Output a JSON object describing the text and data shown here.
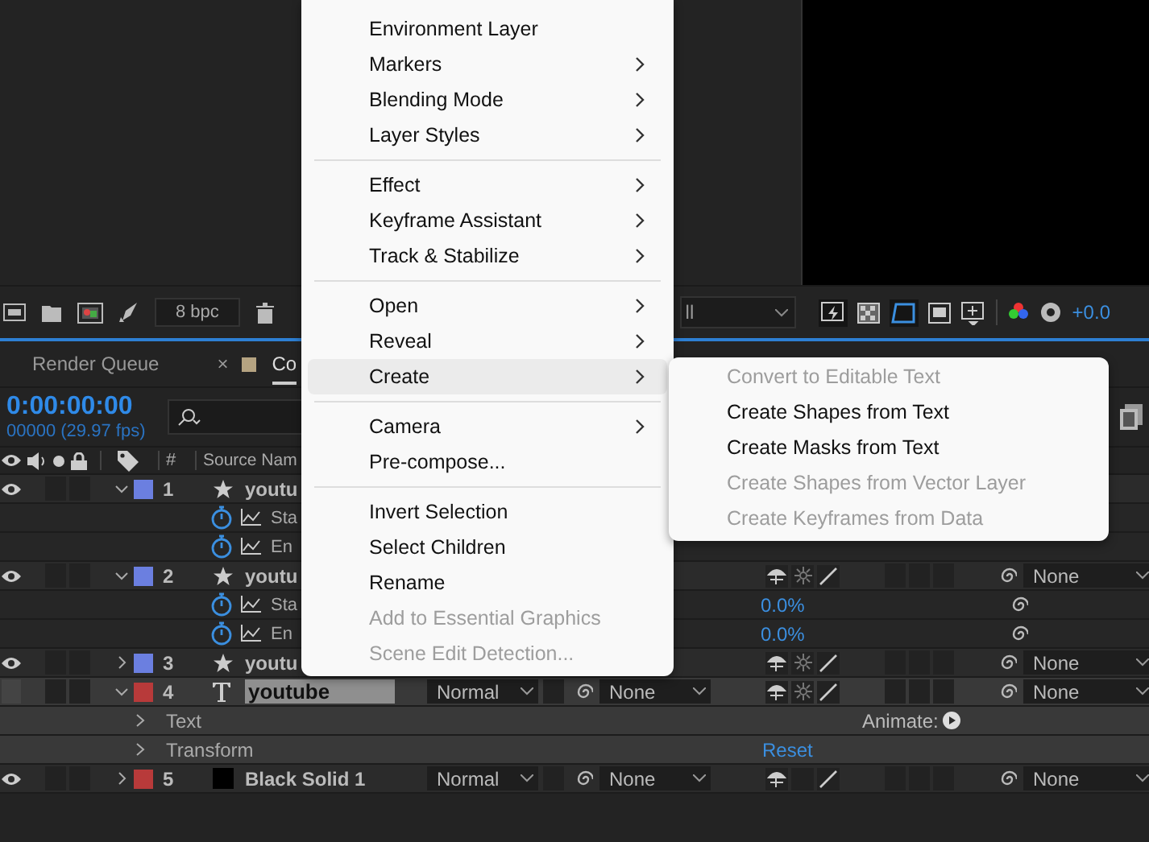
{
  "toolbar": {
    "bit_depth": "8 bpc"
  },
  "viewer_toolbar": {
    "resolution": "ll",
    "exposure": "+0.0"
  },
  "tabs": [
    {
      "label": "Render Queue",
      "selected": false
    },
    {
      "label": "Co",
      "selected": true,
      "close": "×",
      "color": "#b5a381"
    }
  ],
  "timeline": {
    "timecode": "0:00:00:00",
    "frames": "00000 (29.97 fps)",
    "columns": [
      "#",
      "Source Nam"
    ],
    "layers": [
      {
        "index": "1",
        "name": "youtu",
        "kind": "shape",
        "color": "#6b7fe0",
        "visible": true,
        "expanded": true,
        "selected": false,
        "children": [
          {
            "kind": "property",
            "name": "Sta"
          },
          {
            "kind": "property",
            "name": "En"
          }
        ]
      },
      {
        "index": "2",
        "name": "youtu",
        "kind": "shape",
        "color": "#6b7fe0",
        "visible": true,
        "expanded": true,
        "selected": false,
        "parent": "None",
        "children": [
          {
            "kind": "property",
            "name": "Sta",
            "value": "0.0%"
          },
          {
            "kind": "property",
            "name": "En",
            "value": "0.0%"
          }
        ]
      },
      {
        "index": "3",
        "name": "youtu",
        "kind": "shape",
        "color": "#6b7fe0",
        "visible": true,
        "expanded": false,
        "selected": false,
        "parent": "None"
      },
      {
        "index": "4",
        "name": "youtube",
        "kind": "text",
        "color": "#b83a3a",
        "visible": false,
        "expanded": true,
        "selected": true,
        "renaming": true,
        "mode": "Normal",
        "track_matte": "None",
        "parent": "None",
        "children": [
          {
            "kind": "group",
            "name": "Text",
            "animate": "Animate:"
          },
          {
            "kind": "group",
            "name": "Transform",
            "value": "Reset"
          }
        ]
      },
      {
        "index": "5",
        "name": "Black Solid 1",
        "kind": "solid",
        "color": "#b83a3a",
        "visible": true,
        "expanded": false,
        "selected": false,
        "mode": "Normal",
        "track_matte": "None",
        "parent": "None"
      }
    ]
  },
  "context_menu": {
    "items": [
      {
        "kind": "item",
        "label": "Environment Layer",
        "submenu": false,
        "disabled": false,
        "selected": false
      },
      {
        "kind": "item",
        "label": "Markers",
        "submenu": true,
        "disabled": false,
        "selected": false
      },
      {
        "kind": "item",
        "label": "Blending Mode",
        "submenu": true,
        "disabled": false,
        "selected": false
      },
      {
        "kind": "item",
        "label": "Layer Styles",
        "submenu": true,
        "disabled": false,
        "selected": false
      },
      {
        "kind": "separator"
      },
      {
        "kind": "item",
        "label": "Effect",
        "submenu": true,
        "disabled": false,
        "selected": false
      },
      {
        "kind": "item",
        "label": "Keyframe Assistant",
        "submenu": true,
        "disabled": false,
        "selected": false
      },
      {
        "kind": "item",
        "label": "Track & Stabilize",
        "submenu": true,
        "disabled": false,
        "selected": false
      },
      {
        "kind": "separator"
      },
      {
        "kind": "item",
        "label": "Open",
        "submenu": true,
        "disabled": false,
        "selected": false
      },
      {
        "kind": "item",
        "label": "Reveal",
        "submenu": true,
        "disabled": false,
        "selected": false
      },
      {
        "kind": "item",
        "label": "Create",
        "submenu": true,
        "disabled": false,
        "selected": true
      },
      {
        "kind": "separator"
      },
      {
        "kind": "item",
        "label": "Camera",
        "submenu": true,
        "disabled": false,
        "selected": false
      },
      {
        "kind": "item",
        "label": "Pre-compose...",
        "submenu": false,
        "disabled": false,
        "selected": false
      },
      {
        "kind": "separator"
      },
      {
        "kind": "item",
        "label": "Invert Selection",
        "submenu": false,
        "disabled": false,
        "selected": false
      },
      {
        "kind": "item",
        "label": "Select Children",
        "submenu": false,
        "disabled": false,
        "selected": false
      },
      {
        "kind": "item",
        "label": "Rename",
        "submenu": false,
        "disabled": false,
        "selected": false
      },
      {
        "kind": "item",
        "label": "Add to Essential Graphics",
        "submenu": false,
        "disabled": true,
        "selected": false
      },
      {
        "kind": "item",
        "label": "Scene Edit Detection...",
        "submenu": false,
        "disabled": true,
        "selected": false
      }
    ]
  },
  "submenu": {
    "items": [
      {
        "label": "Convert to Editable Text",
        "disabled": true
      },
      {
        "label": "Create Shapes from Text",
        "disabled": false
      },
      {
        "label": "Create Masks from Text",
        "disabled": false
      },
      {
        "label": "Create Shapes from Vector Layer",
        "disabled": true
      },
      {
        "label": "Create Keyframes from Data",
        "disabled": true
      }
    ]
  }
}
